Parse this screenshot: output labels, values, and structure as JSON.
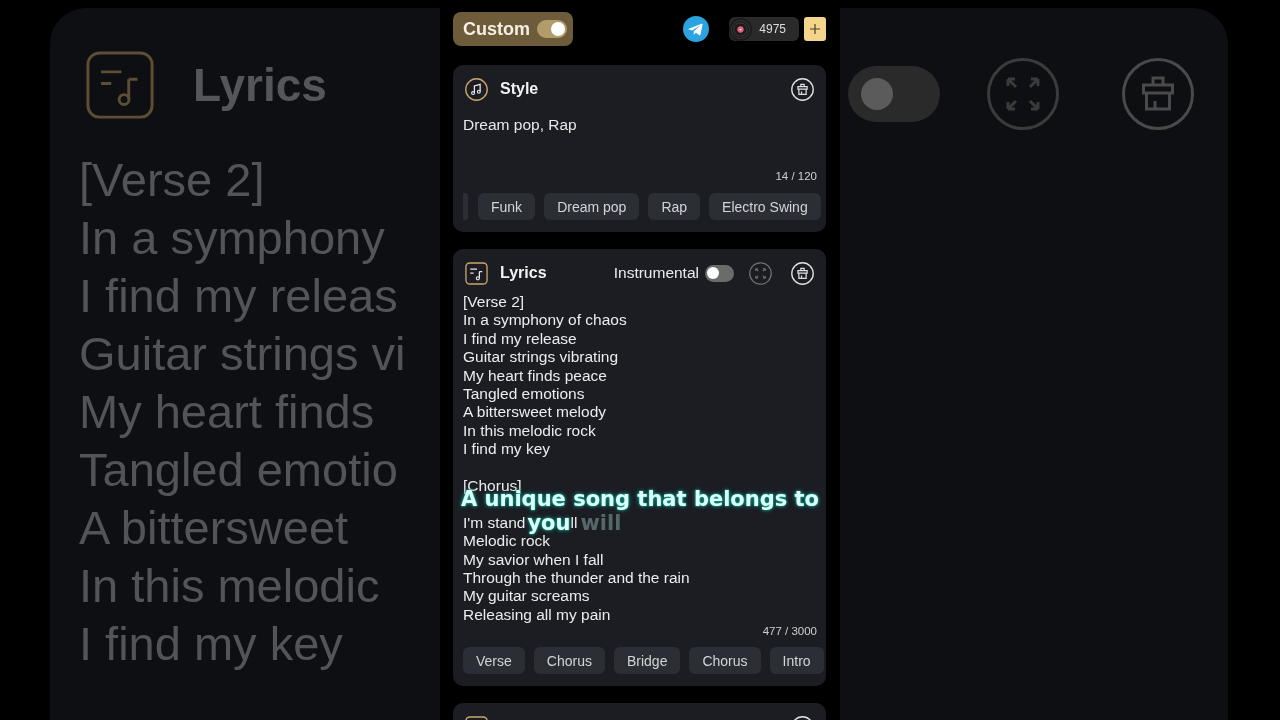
{
  "backdrop_left": {
    "title": "Lyrics",
    "lines": [
      "[Verse 2]",
      "In a symphony",
      "I find my releas",
      "Guitar strings vi",
      "My heart finds",
      "Tangled emotio",
      "A bittersweet",
      "In this melodic",
      "I find my key"
    ]
  },
  "backdrop_right": {
    "instrumental_on": false
  },
  "header": {
    "mode_label": "Custom",
    "custom_on": true,
    "credits": "4975"
  },
  "style_card": {
    "title": "Style",
    "value": "Dream pop, Rap",
    "counter": "14 / 120",
    "tags_scrolled": true,
    "tags": [
      "Funk",
      "Dream pop",
      "Rap",
      "Electro Swing"
    ]
  },
  "lyrics_card": {
    "title": "Lyrics",
    "instrumental_label": "Instrumental",
    "instrumental_on": false,
    "stanzas": [
      [
        {
          "kind": "lyric",
          "text": "[Verse 2]"
        },
        {
          "kind": "lyric",
          "text": "In a symphony of chaos"
        },
        {
          "kind": "lyric",
          "text": "I find my release"
        },
        {
          "kind": "lyric",
          "text": "Guitar strings vibrating"
        },
        {
          "kind": "lyric",
          "text": "My heart finds peace"
        },
        {
          "kind": "lyric",
          "text": "Tangled emotions"
        },
        {
          "kind": "lyric",
          "text": "A bittersweet melody"
        },
        {
          "kind": "lyric",
          "text": "In this melodic rock"
        },
        {
          "kind": "lyric",
          "text": "I find my key"
        }
      ],
      [
        {
          "kind": "lyric",
          "text": "[Chorus]"
        },
        {
          "kind": "caption",
          "text": "A unique song that belongs to"
        },
        {
          "kind": "lyric_with_caption",
          "text": "I'm stand",
          "caption": "you",
          "text_after": "ll",
          "upcoming": "will"
        },
        {
          "kind": "lyric",
          "text": "Melodic rock"
        },
        {
          "kind": "lyric",
          "text": "My savior when I fall"
        },
        {
          "kind": "lyric",
          "text": "Through the thunder and the rain"
        },
        {
          "kind": "lyric",
          "text": "My guitar screams"
        },
        {
          "kind": "lyric",
          "text": "Releasing all my pain"
        }
      ]
    ],
    "counter": "477 / 3000",
    "tags": [
      "Verse",
      "Chorus",
      "Bridge",
      "Chorus",
      "Intro"
    ]
  },
  "next_card_peek": true
}
